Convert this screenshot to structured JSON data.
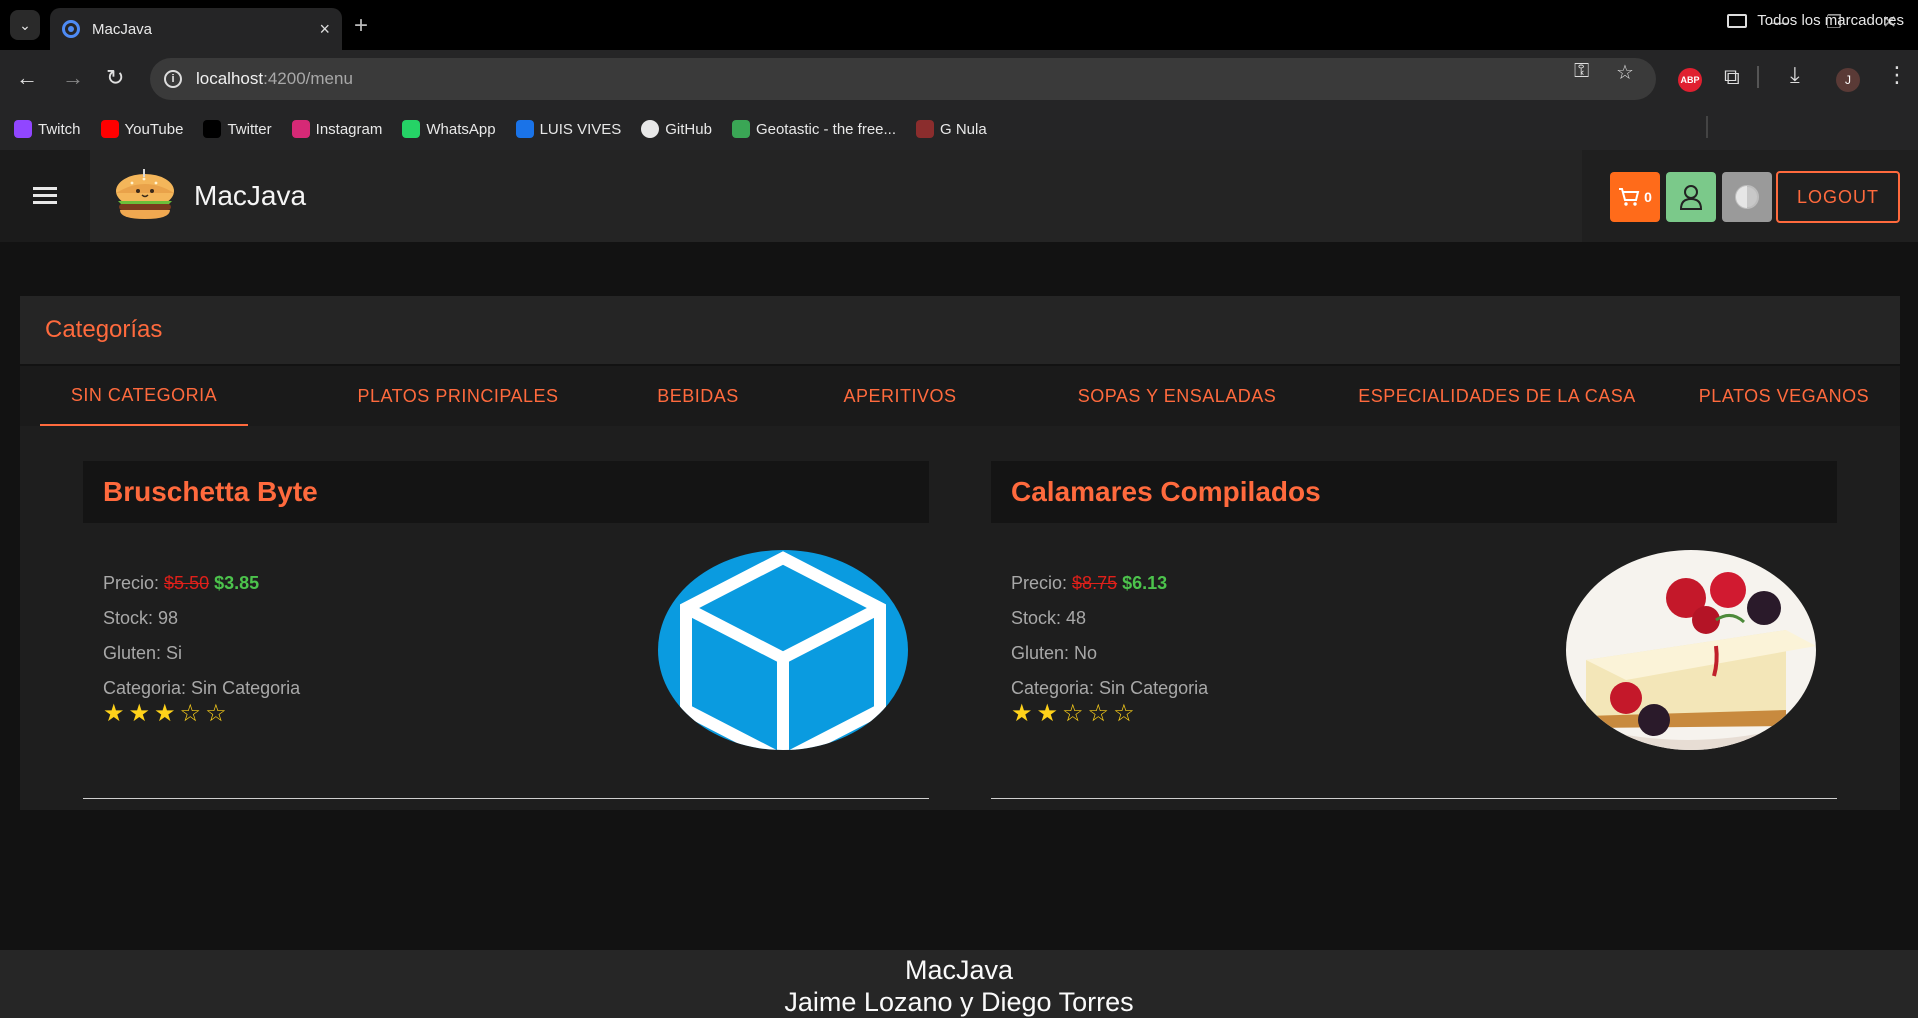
{
  "browser": {
    "tab_title": "MacJava",
    "url_host": "localhost",
    "url_path": ":4200/menu",
    "bookmarks": [
      {
        "label": "Twitch",
        "color": "#9146ff"
      },
      {
        "label": "YouTube",
        "color": "#ff0000"
      },
      {
        "label": "Twitter",
        "color": "#000000"
      },
      {
        "label": "Instagram",
        "color": "#d62976"
      },
      {
        "label": "WhatsApp",
        "color": "#25d366"
      },
      {
        "label": "LUIS VIVES",
        "color": "#1a73e8"
      },
      {
        "label": "GitHub",
        "color": "#ffffff"
      },
      {
        "label": "Geotastic - the free...",
        "color": "#3aa655"
      },
      {
        "label": "G Nula",
        "color": "#8b2d2d"
      }
    ],
    "all_bookmarks": "Todos los marcadores",
    "profile_initial": "J",
    "abp_label": "ABP"
  },
  "header": {
    "brand": "MacJava",
    "cart_count": "0",
    "logout_label": "LOGOUT"
  },
  "categories": {
    "title": "Categorías",
    "tabs": [
      "SIN CATEGORIA",
      "PLATOS PRINCIPALES",
      "BEBIDAS",
      "APERITIVOS",
      "SOPAS Y ENSALADAS",
      "ESPECIALIDADES DE LA CASA",
      "PLATOS VEGANOS"
    ],
    "active_index": 0
  },
  "products": [
    {
      "name": "Bruschetta Byte",
      "price_label": "Precio:",
      "old_price": "$5.50",
      "new_price": "$3.85",
      "stock": "Stock: 98",
      "gluten": "Gluten: Si",
      "category": "Categoria: Sin Categoria",
      "rating": 3,
      "rating_max": 5,
      "stars": "★★★☆☆",
      "image": "cube"
    },
    {
      "name": "Calamares Compilados",
      "price_label": "Precio:",
      "old_price": "$8.75",
      "new_price": "$6.13",
      "stock": "Stock: 48",
      "gluten": "Gluten: No",
      "category": "Categoria: Sin Categoria",
      "rating": 2,
      "rating_max": 5,
      "stars": "★★☆☆☆",
      "image": "cheesecake"
    }
  ],
  "footer": {
    "line1": "MacJava",
    "line2": "Jaime Lozano y Diego Torres"
  },
  "colors": {
    "accent": "#ff6a3d",
    "cart": "#ff6b1a",
    "user": "#7bc98a",
    "price_old": "#e0201a",
    "price_new": "#4cc34c",
    "star": "#ffd21a"
  }
}
